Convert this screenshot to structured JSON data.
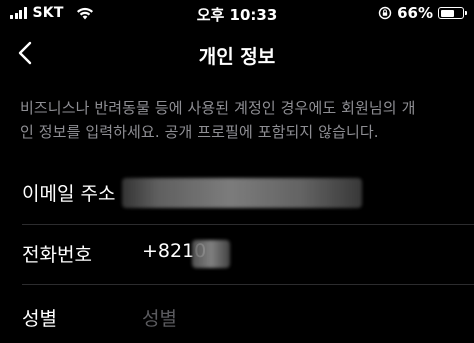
{
  "status_bar": {
    "carrier": "SKT",
    "time": "오후 10:33",
    "battery": "66%",
    "battery_level": 0.66
  },
  "nav": {
    "title": "개인 정보"
  },
  "info": {
    "line1": "비즈니스나 반려동물 등에 사용된 계정인 경우에도 회원님의 개",
    "line2": "인 정보를 입력하세요. 공개 프로필에 포함되지 않습니다."
  },
  "fields": {
    "email": {
      "label": "이메일 주소",
      "value": ""
    },
    "phone": {
      "label": "전화번호",
      "value": "+8210"
    },
    "gender": {
      "label": "성별",
      "placeholder": "성별"
    }
  }
}
